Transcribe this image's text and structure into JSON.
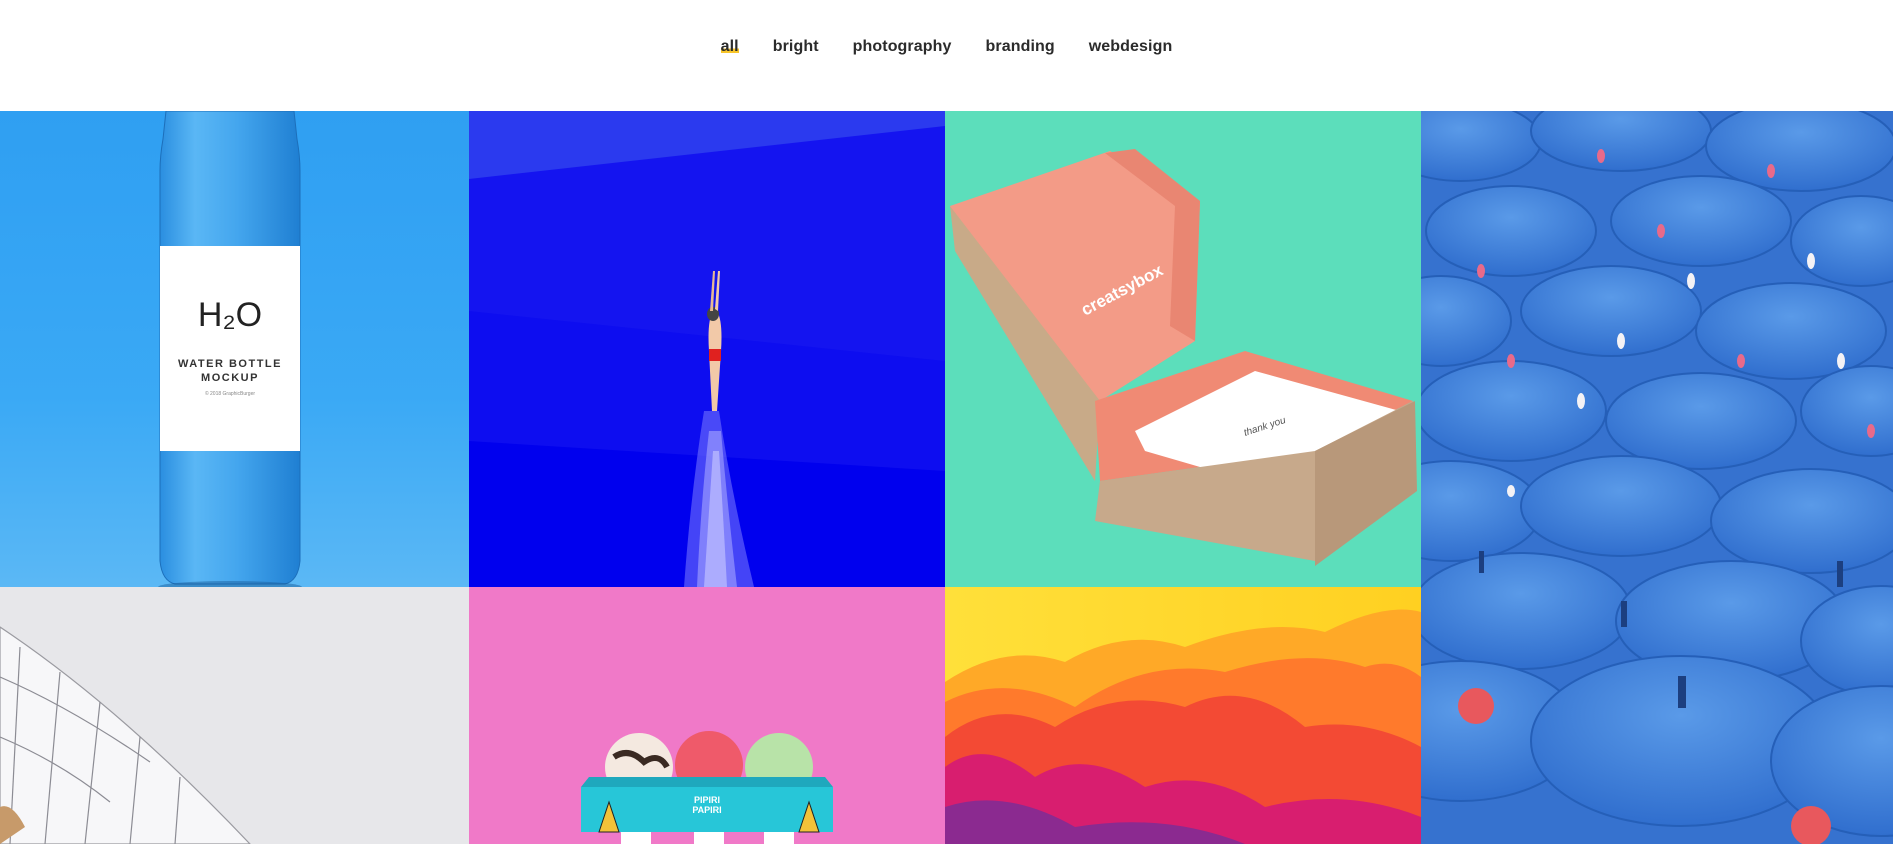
{
  "filters": [
    {
      "label": "all",
      "active": true
    },
    {
      "label": "bright",
      "active": false
    },
    {
      "label": "photography",
      "active": false
    },
    {
      "label": "branding",
      "active": false
    },
    {
      "label": "webdesign",
      "active": false
    }
  ],
  "bottle": {
    "brand": "H₂O",
    "line1": "WATER BOTTLE",
    "line2": "MOCKUP",
    "credit": "© 2018 GraphicBurger"
  },
  "box": {
    "logo": "creatsybox",
    "note": "thank you"
  },
  "icecream": {
    "brand_line1": "PIPIRI",
    "brand_line2": "PAPIRI"
  },
  "colors": {
    "accent": "#f7c52a",
    "text": "#2b2b2b"
  }
}
